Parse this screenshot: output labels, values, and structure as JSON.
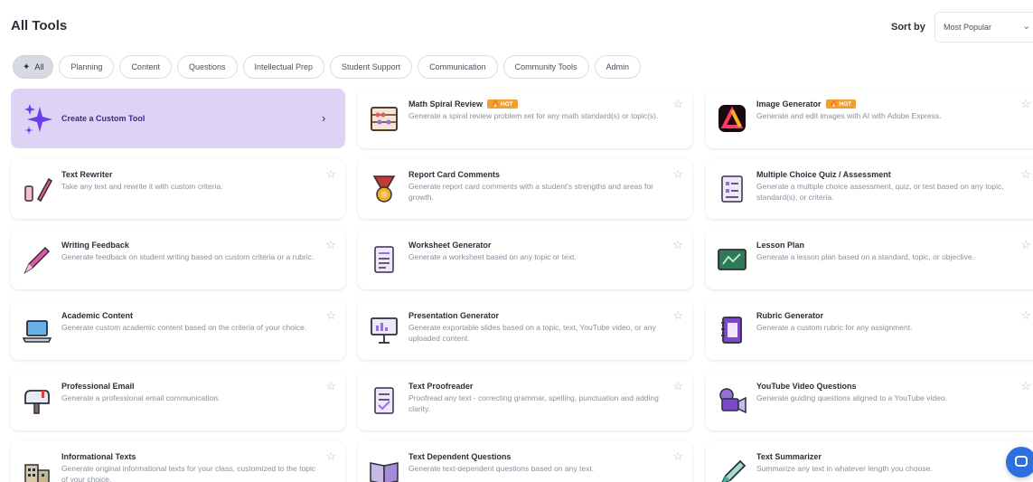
{
  "header": {
    "title": "All Tools",
    "sort_label": "Sort by",
    "sort_value": "Most Popular"
  },
  "filters": [
    {
      "label": "All",
      "active": true
    },
    {
      "label": "Planning",
      "active": false
    },
    {
      "label": "Content",
      "active": false
    },
    {
      "label": "Questions",
      "active": false
    },
    {
      "label": "Intellectual Prep",
      "active": false
    },
    {
      "label": "Student Support",
      "active": false
    },
    {
      "label": "Communication",
      "active": false
    },
    {
      "label": "Community Tools",
      "active": false
    },
    {
      "label": "Admin",
      "active": false
    }
  ],
  "custom_tool": {
    "label": "Create a Custom Tool"
  },
  "badge_text": "HOT",
  "tools": [
    {
      "title": "Math Spiral Review",
      "hot": true,
      "description": "Generate a spiral review problem set for any math standard(s) or topic(s).",
      "icon": "abacus-icon"
    },
    {
      "title": "Image Generator",
      "hot": true,
      "description": "Generate and edit images with AI with Adobe Express.",
      "icon": "adobe-express-icon"
    },
    {
      "title": "Text Rewriter",
      "hot": false,
      "description": "Take any text and rewrite it with custom criteria.",
      "icon": "pencil-eraser-icon"
    },
    {
      "title": "Report Card Comments",
      "hot": false,
      "description": "Generate report card comments with a student's strengths and areas for growth.",
      "icon": "medal-icon"
    },
    {
      "title": "Multiple Choice Quiz / Assessment",
      "hot": false,
      "description": "Generate a multiple choice assessment, quiz, or test based on any topic, standard(s), or criteria.",
      "icon": "quiz-sheet-icon"
    },
    {
      "title": "Writing Feedback",
      "hot": false,
      "description": "Generate feedback on student writing based on custom criteria or a rubric.",
      "icon": "pen-icon"
    },
    {
      "title": "Worksheet Generator",
      "hot": false,
      "description": "Generate a worksheet based on any topic or text.",
      "icon": "worksheet-icon"
    },
    {
      "title": "Lesson Plan",
      "hot": false,
      "description": "Generate a lesson plan based on a standard, topic, or objective.",
      "icon": "chalkboard-icon"
    },
    {
      "title": "Academic Content",
      "hot": false,
      "description": "Generate custom academic content based on the criteria of your choice.",
      "icon": "laptop-icon"
    },
    {
      "title": "Presentation Generator",
      "hot": false,
      "description": "Generate exportable slides based on a topic, text, YouTube video, or any uploaded content.",
      "icon": "presentation-board-icon"
    },
    {
      "title": "Rubric Generator",
      "hot": false,
      "description": "Generate a custom rubric for any assignment.",
      "icon": "notebook-icon"
    },
    {
      "title": "Professional Email",
      "hot": false,
      "description": "Generate a professional email communication.",
      "icon": "mailbox-icon"
    },
    {
      "title": "Text Proofreader",
      "hot": false,
      "description": "Proofread any text - correcting grammar, spelling, punctuation and adding clarity.",
      "icon": "proofread-sheet-icon"
    },
    {
      "title": "YouTube Video Questions",
      "hot": false,
      "description": "Generate guiding questions aligned to a YouTube video.",
      "icon": "video-camera-icon"
    },
    {
      "title": "Informational Texts",
      "hot": false,
      "description": "Generate original informational texts for your class, customized to the topic of your choice.",
      "icon": "building-icon"
    },
    {
      "title": "Text Dependent Questions",
      "hot": false,
      "description": "Generate text-dependent questions based on any text.",
      "icon": "open-book-icon"
    },
    {
      "title": "Text Summarizer",
      "hot": false,
      "description": "Summarize any text in whatever length you choose.",
      "icon": "highlighter-icon"
    }
  ]
}
